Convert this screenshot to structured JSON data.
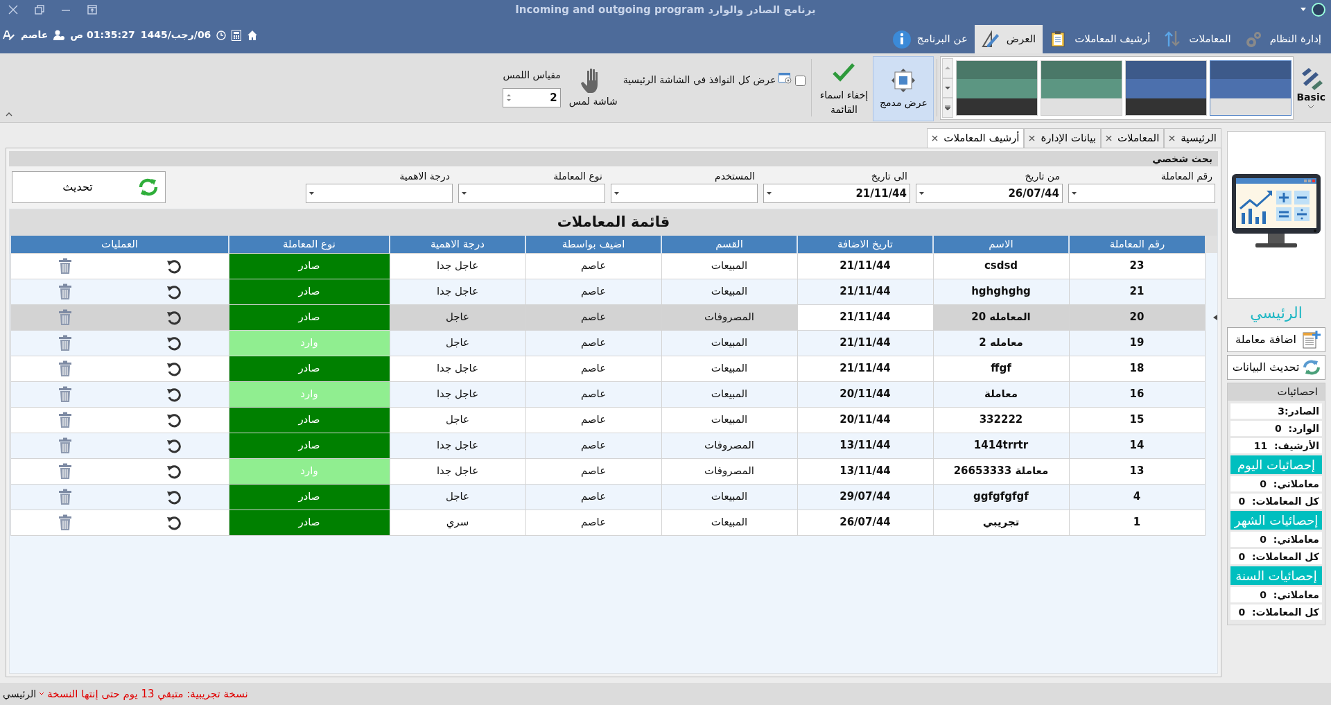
{
  "window": {
    "title": "برنامج الصادر والوارد Incoming and outgoing program"
  },
  "ribbon_tabs": [
    {
      "label": "إدارة النظام",
      "selected": false
    },
    {
      "label": "المعاملات",
      "selected": false
    },
    {
      "label": "أرشيف المعاملات",
      "selected": false
    },
    {
      "label": "العرض",
      "selected": true
    },
    {
      "label": "عن البرنامج",
      "selected": false
    }
  ],
  "status_info": {
    "date": "06/رجب/1445",
    "time": "01:35:27 ص",
    "user": "عاصم"
  },
  "ribbon": {
    "theme": "Basic",
    "theme_gallery": [
      {
        "color": "#3d5a8a",
        "kind": "light",
        "selected": true
      },
      {
        "color": "#3d5a8a",
        "kind": "dark",
        "selected": false
      },
      {
        "color": "#4a7868",
        "kind": "light",
        "selected": false
      },
      {
        "color": "#4a7868",
        "kind": "dark",
        "selected": false
      }
    ],
    "buttons": [
      {
        "label": "عرض مدمج",
        "on": true
      },
      {
        "label": "إخفاء اسماء القائمة",
        "on": false
      }
    ],
    "show_all_windows": {
      "label": "عرض كل النوافذ في الشاشة الرئيسية",
      "checked": false
    },
    "touch_screen": {
      "label": "شاشة لمس"
    },
    "touch_scale": {
      "label": "مقياس اللمس",
      "value": "2"
    }
  },
  "document_tabs": [
    {
      "label": "الرئيسية",
      "selected": false
    },
    {
      "label": "المعاملات",
      "selected": false
    },
    {
      "label": "بيانات الإدارة",
      "selected": false
    },
    {
      "label": "أرشيف المعاملات",
      "selected": true
    }
  ],
  "search_panel": {
    "title": "بحث شخصي",
    "fields": [
      {
        "label": "رقم المعاملة"
      },
      {
        "label": "من تاريخ",
        "value": "26/07/44"
      },
      {
        "label": "الى تاريخ",
        "value": "21/11/44"
      },
      {
        "label": "المستخدم"
      },
      {
        "label": "نوع المعاملة"
      },
      {
        "label": "درجة الاهمية"
      }
    ],
    "refresh_button": "تحديث"
  },
  "table": {
    "title": "قائمة المعاملات",
    "columns": [
      "رقم المعاملة",
      "الاسم",
      "تاريخ الاضافة",
      "القسم",
      "اضيف بواسطة",
      "درجة الاهمية",
      "نوع المعاملة",
      "العمليات"
    ],
    "rows": [
      {
        "cells": [
          "23",
          "csdsd",
          "21/11/44",
          "المبيعات",
          "عاصم",
          "عاجل جدا",
          "صادر"
        ],
        "kind": "outgoing",
        "selected": false
      },
      {
        "cells": [
          "21",
          "hghghghg",
          "21/11/44",
          "المبيعات",
          "عاصم",
          "عاجل جدا",
          "صادر"
        ],
        "kind": "outgoing",
        "selected": false
      },
      {
        "cells": [
          "20",
          "المعامله 20",
          "21/11/44",
          "المصروفات",
          "عاصم",
          "عاجل",
          "صادر"
        ],
        "kind": "outgoing",
        "selected": true
      },
      {
        "cells": [
          "19",
          "معامله 2",
          "21/11/44",
          "المبيعات",
          "عاصم",
          "عاجل",
          "وارد"
        ],
        "kind": "incoming",
        "selected": false
      },
      {
        "cells": [
          "18",
          "ffgf",
          "21/11/44",
          "المبيعات",
          "عاصم",
          "عاجل جدا",
          "صادر"
        ],
        "kind": "outgoing",
        "selected": false
      },
      {
        "cells": [
          "16",
          "معاملة",
          "20/11/44",
          "المبيعات",
          "عاصم",
          "عاجل جدا",
          "وارد"
        ],
        "kind": "incoming",
        "selected": false
      },
      {
        "cells": [
          "15",
          "332222",
          "20/11/44",
          "المبيعات",
          "عاصم",
          "عاجل",
          "صادر"
        ],
        "kind": "outgoing",
        "selected": false
      },
      {
        "cells": [
          "14",
          "1414trrtr",
          "13/11/44",
          "المصروفات",
          "عاصم",
          "عاجل جدا",
          "صادر"
        ],
        "kind": "outgoing",
        "selected": false
      },
      {
        "cells": [
          "13",
          "معاملة 26653333",
          "13/11/44",
          "المصروفات",
          "عاصم",
          "عاجل جدا",
          "وارد"
        ],
        "kind": "incoming",
        "selected": false
      },
      {
        "cells": [
          "4",
          "ggfgfgfgf",
          "29/07/44",
          "المبيعات",
          "عاصم",
          "عاجل",
          "صادر"
        ],
        "kind": "outgoing",
        "selected": false
      },
      {
        "cells": [
          "1",
          "تجريبي",
          "26/07/44",
          "المبيعات",
          "عاصم",
          "سري",
          "صادر"
        ],
        "kind": "outgoing",
        "selected": false
      }
    ]
  },
  "sidebar": {
    "title": "الرئيسي",
    "buttons": [
      "اضافة معاملة",
      "تحديث البيانات"
    ],
    "stats_title": "احصائيات",
    "stats": [
      "الصادر:3",
      "الوارد:  0",
      "الأرشيف:  11"
    ],
    "sections": [
      {
        "title": "إحصائيات اليوم",
        "items": [
          "معاملاتي:  0",
          "كل المعاملات:  0"
        ]
      },
      {
        "title": "إحصائيات الشهر",
        "items": [
          "معاملاتي:  0",
          "كل المعاملات:  0"
        ]
      },
      {
        "title": "إحصائيات السنة",
        "items": [
          "معاملاتي:  0",
          "كل المعاملات:  0"
        ]
      }
    ]
  },
  "status_bar": {
    "page": "الرئيسي",
    "notice": "نسخة تجريبية: متبقي 13 يوم حتى إنتها النسخة"
  }
}
